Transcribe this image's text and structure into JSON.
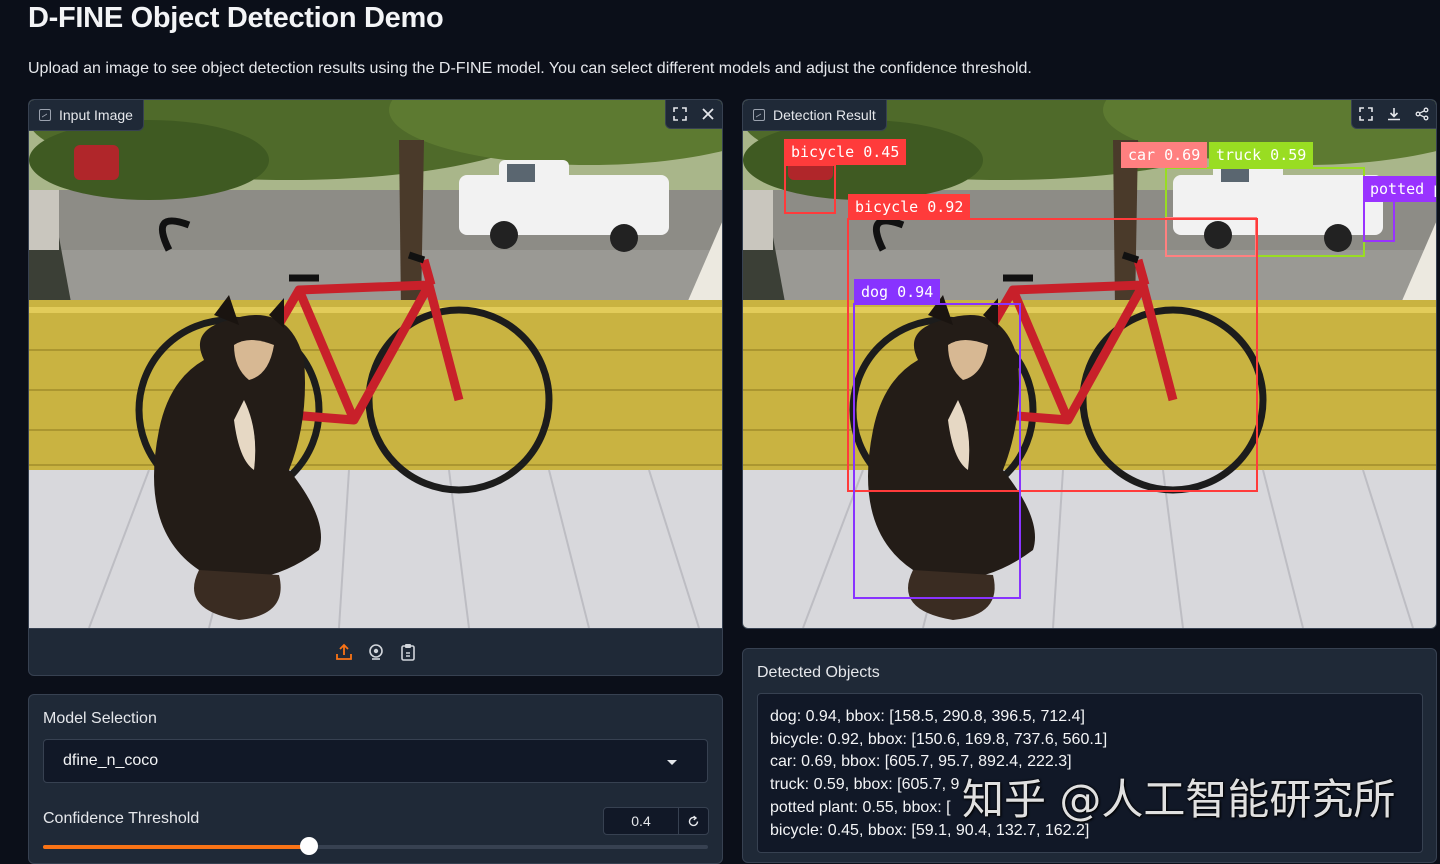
{
  "page": {
    "title": "D-FINE Object Detection Demo",
    "description": "Upload an image to see object detection results using the D-FINE model. You can select different models and adjust the confidence threshold."
  },
  "input_panel": {
    "label": "Input Image",
    "icon": "image-icon",
    "corner_icons": [
      "fullscreen-icon",
      "close-icon"
    ],
    "source_icons": [
      "upload-icon",
      "webcam-icon",
      "clipboard-icon"
    ],
    "accent_color": "#f97316"
  },
  "result_panel": {
    "label": "Detection Result",
    "icon": "image-icon",
    "corner_icons": [
      "fullscreen-icon",
      "download-icon",
      "share-icon"
    ],
    "detections": [
      {
        "label": "bicycle 0.45",
        "color": "#ff3b3b"
      },
      {
        "label": "car 0.69",
        "color": "#ff8080"
      },
      {
        "label": "truck 0.59",
        "color": "#99dd22"
      },
      {
        "label": "potted p",
        "color": "#9933ff"
      },
      {
        "label": "bicycle 0.92",
        "color": "#ff3b3b"
      },
      {
        "label": "dog 0.94",
        "color": "#8833ff"
      }
    ]
  },
  "model": {
    "label": "Model Selection",
    "selected": "dfine_n_coco"
  },
  "threshold": {
    "label": "Confidence Threshold",
    "value": "0.4",
    "fraction": 0.4
  },
  "detected": {
    "label": "Detected Objects",
    "lines": [
      "dog: 0.94, bbox: [158.5, 290.8, 396.5, 712.4]",
      "bicycle: 0.92, bbox: [150.6, 169.8, 737.6, 560.1]",
      "car: 0.69, bbox: [605.7, 95.7, 892.4, 222.3]",
      "truck: 0.59, bbox: [605.7, 9",
      "potted plant: 0.55, bbox: [",
      "bicycle: 0.45, bbox: [59.1, 90.4, 132.7, 162.2]"
    ]
  },
  "watermark": "知乎 @人工智能研究所"
}
